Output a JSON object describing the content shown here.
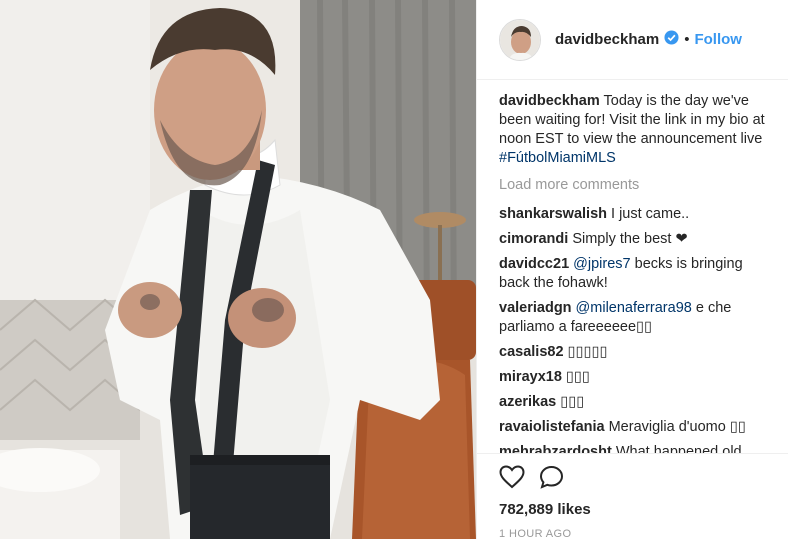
{
  "post": {
    "author": "davidbeckham",
    "follow_label": "Follow",
    "separator": "•"
  },
  "caption": {
    "user": "davidbeckham",
    "text": " Today is the day we've been waiting for! Visit the link in my bio at noon EST to view the announcement live ",
    "hashtag": "#FútbolMiamiMLS"
  },
  "load_more": "Load more comments",
  "comments": [
    {
      "user": "shankarswalish",
      "mention": "",
      "text": " I just came.."
    },
    {
      "user": "cimorandi",
      "mention": "",
      "text": " Simply the best ❤"
    },
    {
      "user": "davidcc21",
      "mention": " @jpires7",
      "text": " becks is bringing back the fohawk!"
    },
    {
      "user": "valeriadgn",
      "mention": " @milenaferrara98",
      "text": " e che parliamo a fareeeeee▯▯"
    },
    {
      "user": "casalis82",
      "mention": "",
      "text": " ▯▯▯▯▯"
    },
    {
      "user": "mirayx18",
      "mention": "",
      "text": " ▯▯▯"
    },
    {
      "user": "azerikas",
      "mention": "",
      "text": " ▯▯▯"
    },
    {
      "user": "ravaiolistefania",
      "mention": "",
      "text": " Meraviglia d'uomo ▯▯"
    },
    {
      "user": "mehrabzardosht",
      "mention": "",
      "text": " What happened old man you are very young▯▯▯▯▯"
    }
  ],
  "likes": "782,889 likes",
  "timestamp": "1 HOUR AGO",
  "icons": {
    "like": "heart-icon",
    "comment": "comment-icon",
    "verified": "verified-badge-icon"
  },
  "colors": {
    "link": "#3897f0",
    "hashtag": "#003569",
    "muted": "#999999",
    "text": "#262626"
  }
}
